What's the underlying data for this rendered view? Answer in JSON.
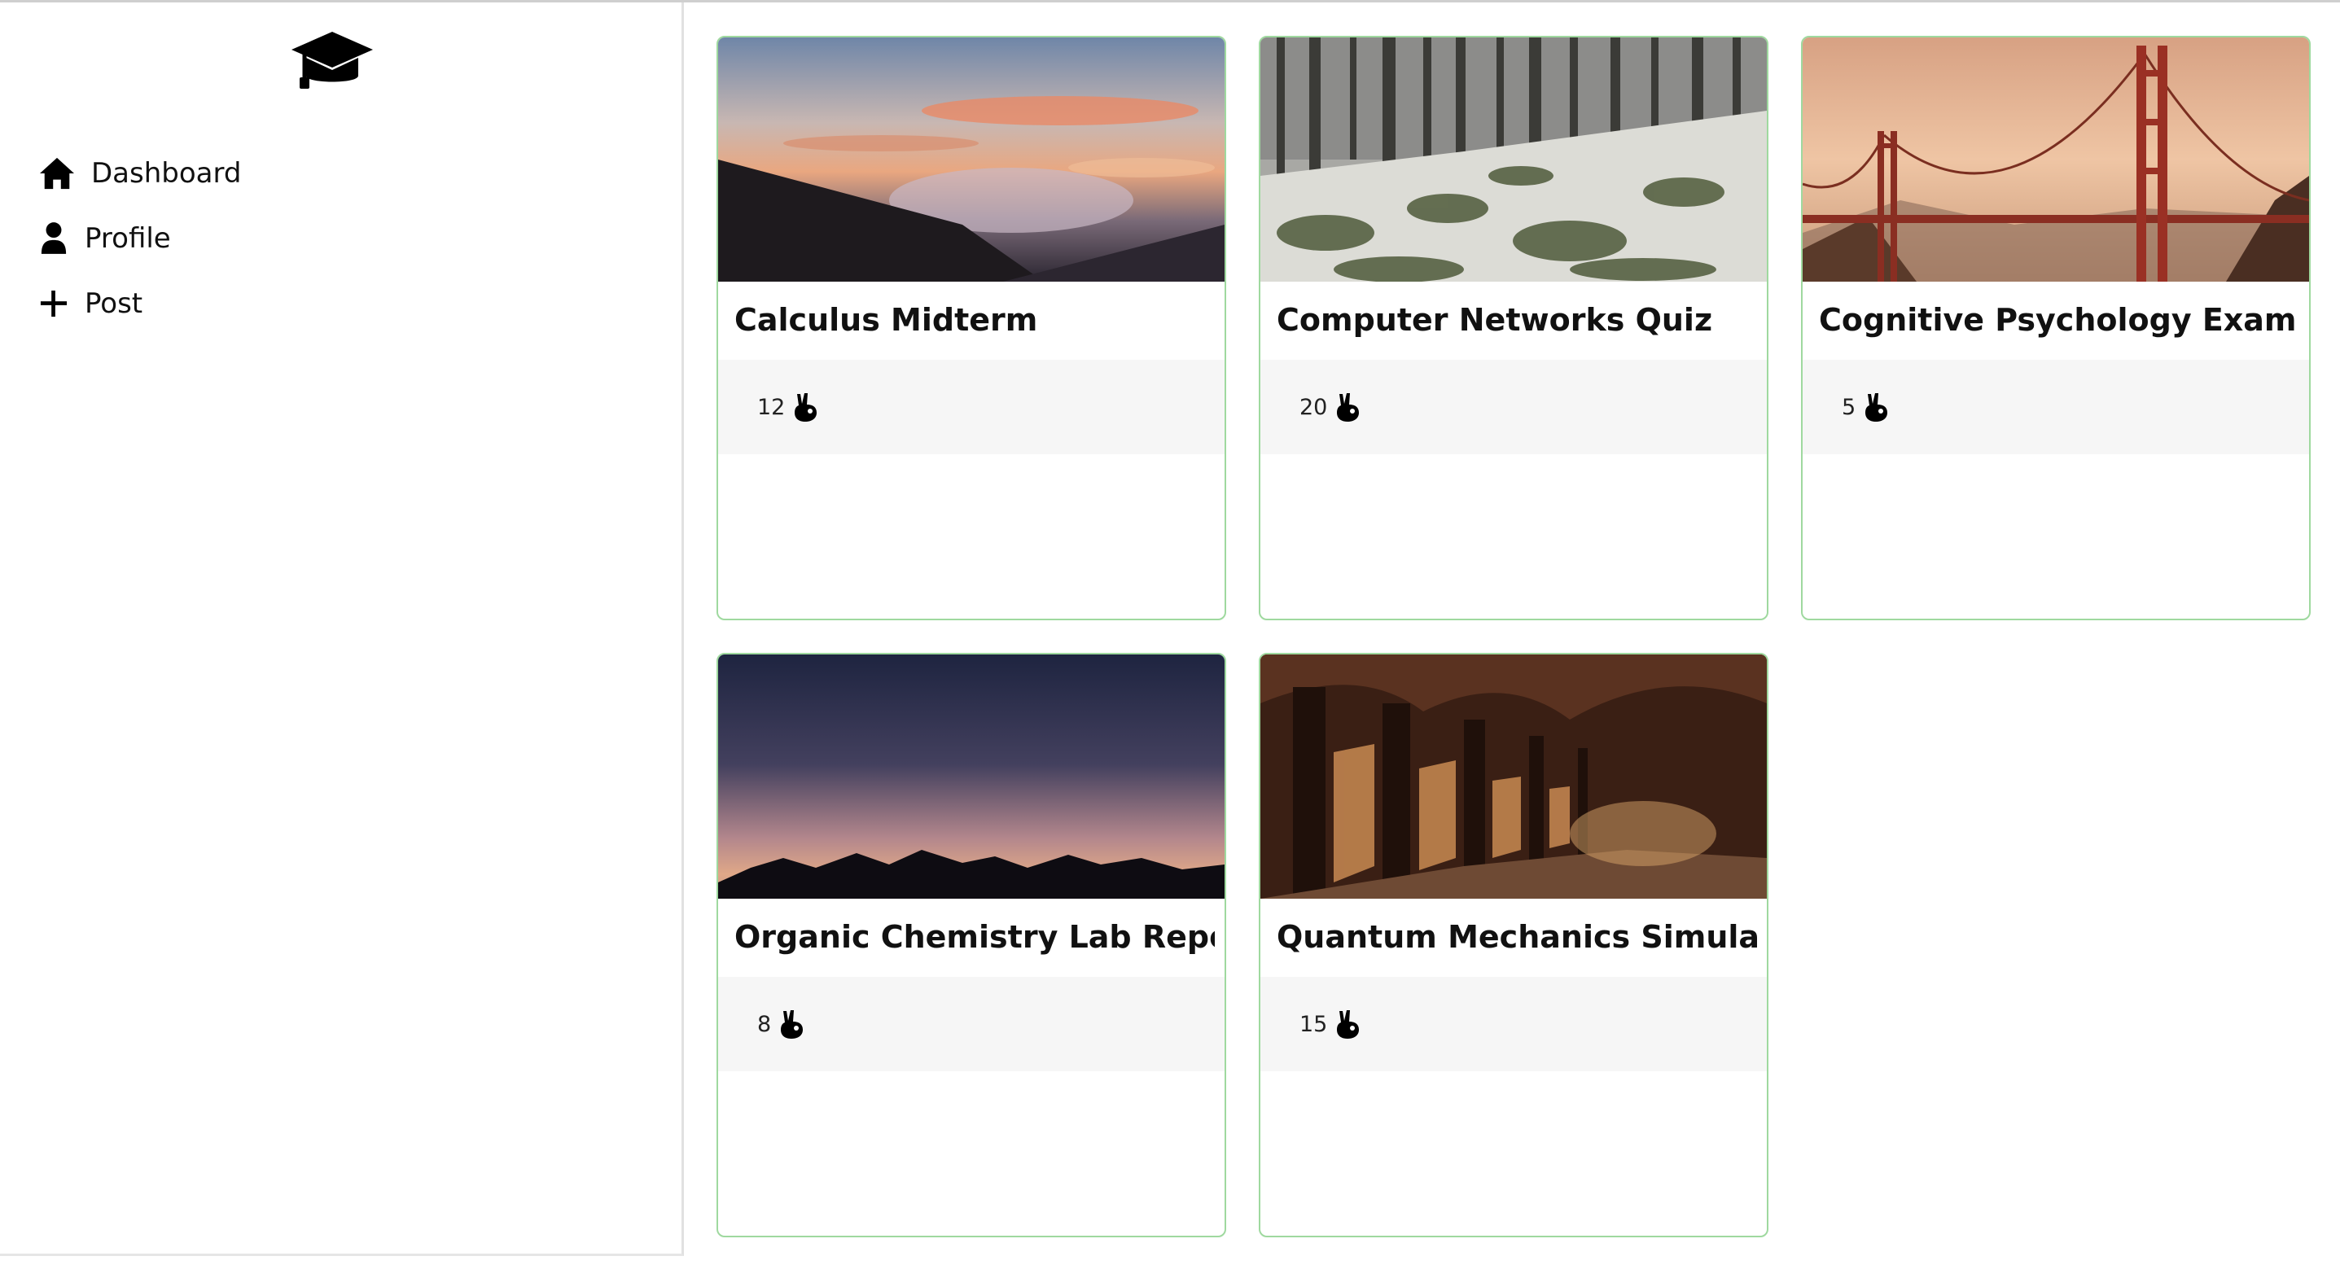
{
  "sidebar": {
    "logo_icon": "graduation-cap-icon",
    "items": [
      {
        "label": "Dashboard",
        "icon": "home-icon"
      },
      {
        "label": "Profile",
        "icon": "user-icon"
      },
      {
        "label": "Post",
        "icon": "plus-icon"
      }
    ]
  },
  "cards": [
    {
      "title": "Calculus Midterm",
      "count": "12",
      "icon": "peace-hand-icon",
      "image": "sunset-clouds-photo"
    },
    {
      "title": "Computer Networks Quiz",
      "count": "20",
      "icon": "peace-hand-icon",
      "image": "snowy-forest-photo"
    },
    {
      "title": "Cognitive Psychology Exam",
      "count": "5",
      "icon": "peace-hand-icon",
      "image": "golden-gate-bridge-photo"
    },
    {
      "title": "Organic Chemistry Lab Report",
      "count": "8",
      "icon": "peace-hand-icon",
      "image": "mountain-dusk-photo"
    },
    {
      "title": "Quantum Mechanics Simulation",
      "count": "15",
      "icon": "peace-hand-icon",
      "image": "cloister-corridor-photo"
    }
  ],
  "colors": {
    "card_border": "#9fd99f",
    "stats_bg": "#f6f6f6",
    "sidebar_border": "#e1e1e1"
  }
}
